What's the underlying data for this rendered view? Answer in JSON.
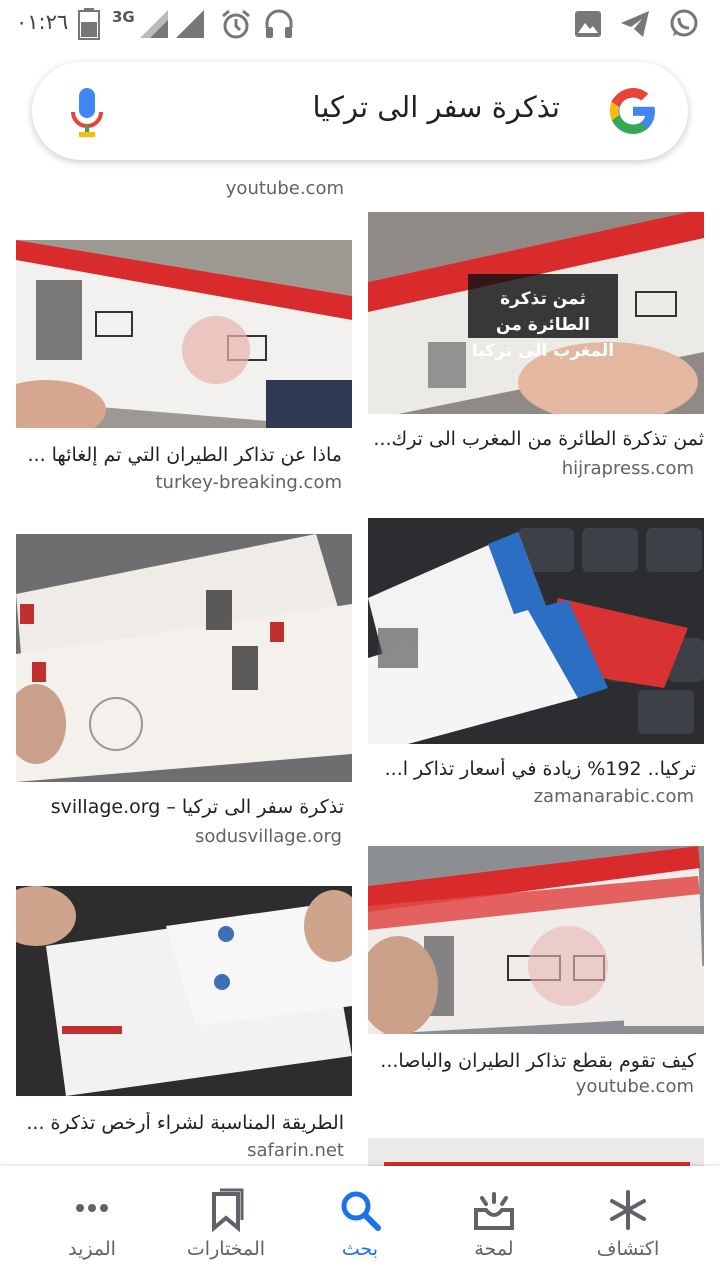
{
  "status_bar": {
    "time": "٠١:٢٦",
    "network": "3G"
  },
  "search": {
    "query": "تذكرة سفر الى تركيا"
  },
  "results": {
    "top_source": "youtube.com",
    "items": [
      {
        "title": "ثمن تذكرة الطائرة من المغرب الى ترك...",
        "site": "hijrapress.com",
        "overlay": "ثمن تذكرة الطائرة من المغرب الى تركيا"
      },
      {
        "title": "ماذا عن تذاكر الطيران التي تم إلغائها ...",
        "site": "turkey-breaking.com"
      },
      {
        "title": "تركيا.. 192% زيادة في أسعار تذاكر ا...",
        "site": "zamanarabic.com"
      },
      {
        "title": "تذكرة سفر الى تركيا – svillage.org",
        "site": "sodusvillage.org"
      },
      {
        "title": "كيف تقوم بقطع تذاكر الطيران والباصا...",
        "site": "youtube.com"
      },
      {
        "title": "الطريقة المناسبة لشراء أرخص تذكرة ...",
        "site": "safarin.net"
      }
    ]
  },
  "bottom_nav": {
    "items": [
      {
        "label": "اكتشاف",
        "icon": "asterisk-icon"
      },
      {
        "label": "لمحة",
        "icon": "inbox-tray-icon"
      },
      {
        "label": "بحث",
        "icon": "search-icon",
        "active": true
      },
      {
        "label": "المختارات",
        "icon": "bookmarks-icon"
      },
      {
        "label": "المزيد",
        "icon": "more-dots-icon"
      }
    ]
  },
  "colors": {
    "accent": "#1a73e8",
    "ticket_red": "#d92b2b",
    "ticket_blue": "#2a6fc4"
  }
}
